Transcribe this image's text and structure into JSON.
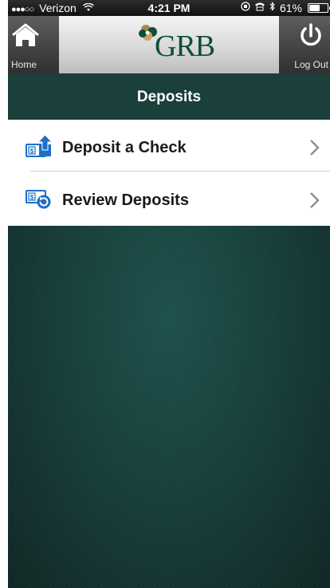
{
  "status_bar": {
    "signal_dots": "●●●○○",
    "carrier": "Verizon",
    "wifi_icon": "wifi-icon",
    "time": "4:21 PM",
    "battery_percent": "61%",
    "battery_level": 0.61
  },
  "nav": {
    "home_label": "Home",
    "logout_label": "Log Out",
    "logo_text": "GRB",
    "brand_colors": {
      "green": "#0f4d3e",
      "gold": "#a8874a"
    }
  },
  "header": {
    "title": "Deposits"
  },
  "menu": {
    "items": [
      {
        "label": "Deposit a Check",
        "icon": "deposit-check-icon"
      },
      {
        "label": "Review Deposits",
        "icon": "review-deposits-icon"
      }
    ]
  },
  "theme": {
    "title_bar_color": "#1b3f3b",
    "background_color": "#173f3b",
    "icon_blue": "#1e6fc7"
  }
}
